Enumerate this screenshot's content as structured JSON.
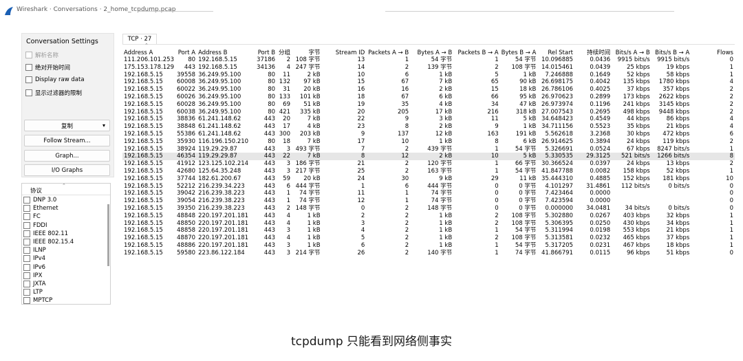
{
  "window": {
    "title": "Wireshark · Conversations · 2_home_tcpdump.pcap"
  },
  "settings": {
    "title": "Conversation Settings",
    "checkboxes": [
      {
        "label": "解析名称",
        "checked": false,
        "disabled": true
      },
      {
        "label": "绝对开始时间",
        "checked": false,
        "disabled": false
      },
      {
        "label": "Display raw data",
        "checked": false,
        "disabled": false
      },
      {
        "label": "显示过滤器的限制",
        "checked": false,
        "disabled": false
      }
    ],
    "buttons": {
      "copy": "复制",
      "follow": "Follow Stream...",
      "graph": "Graph...",
      "io": "I/O Graphs"
    }
  },
  "protocols": {
    "header": "协议",
    "items": [
      "DNP 3.0",
      "Ethernet",
      "FC",
      "FDDI",
      "IEEE 802.11",
      "IEEE 802.15.4",
      "ILNP",
      "IPv4",
      "IPv6",
      "IPX",
      "JXTA",
      "LTP",
      "MPTCP"
    ]
  },
  "tab": {
    "label": "TCP · 27"
  },
  "table": {
    "columns": [
      "Address A",
      "Port A",
      "Address B",
      "Port B",
      "分组",
      "字节",
      "Stream ID",
      "Packets A → B",
      "Bytes A → B",
      "Packets B → A",
      "Bytes B → A",
      "Rel Start",
      "持续时间",
      "Bits/s A → B",
      "Bits/s B → A",
      "Flows"
    ],
    "rows": [
      [
        "111.206.101.253",
        "80",
        "192.168.5.15",
        "37186",
        "2",
        "108 字节",
        "13",
        "1",
        "54 字节",
        "1",
        "54 字节",
        "10.096885",
        "0.0436",
        "9915 bits/s",
        "9915 bits/s",
        "0"
      ],
      [
        "175.153.178.129",
        "443",
        "192.168.5.15",
        "34136",
        "4",
        "247 字节",
        "14",
        "2",
        "139 字节",
        "2",
        "108 字节",
        "14.015461",
        "0.0439",
        "25 kbps",
        "19 kbps",
        "1"
      ],
      [
        "192.168.5.15",
        "39558",
        "36.249.95.100",
        "80",
        "11",
        "2 kB",
        "10",
        "6",
        "1 kB",
        "5",
        "1 kB",
        "7.246888",
        "0.1649",
        "52 kbps",
        "58 kbps",
        "1"
      ],
      [
        "192.168.5.15",
        "60008",
        "36.249.95.100",
        "80",
        "132",
        "97 kB",
        "15",
        "67",
        "7 kB",
        "65",
        "90 kB",
        "26.698175",
        "0.4042",
        "135 kbps",
        "1780 kbps",
        "4"
      ],
      [
        "192.168.5.15",
        "60022",
        "36.249.95.100",
        "80",
        "31",
        "20 kB",
        "16",
        "16",
        "2 kB",
        "15",
        "18 kB",
        "26.786106",
        "0.4025",
        "37 kbps",
        "357 kbps",
        "2"
      ],
      [
        "192.168.5.15",
        "60026",
        "36.249.95.100",
        "80",
        "133",
        "101 kB",
        "18",
        "67",
        "6 kB",
        "66",
        "95 kB",
        "26.970623",
        "0.2899",
        "173 kbps",
        "2622 kbps",
        "2"
      ],
      [
        "192.168.5.15",
        "60028",
        "36.249.95.100",
        "80",
        "69",
        "51 kB",
        "19",
        "35",
        "4 kB",
        "34",
        "47 kB",
        "26.973974",
        "0.1196",
        "241 kbps",
        "3145 kbps",
        "2"
      ],
      [
        "192.168.5.15",
        "60038",
        "36.249.95.100",
        "80",
        "421",
        "335 kB",
        "20",
        "205",
        "17 kB",
        "216",
        "318 kB",
        "27.007543",
        "0.2695",
        "498 kbps",
        "9448 kbps",
        "2"
      ],
      [
        "192.168.5.15",
        "38836",
        "61.241.148.62",
        "443",
        "20",
        "7 kB",
        "22",
        "9",
        "3 kB",
        "11",
        "5 kB",
        "34.648423",
        "0.4549",
        "44 kbps",
        "86 kbps",
        "4"
      ],
      [
        "192.168.5.15",
        "38848",
        "61.241.148.62",
        "443",
        "17",
        "4 kB",
        "23",
        "8",
        "2 kB",
        "9",
        "1 kB",
        "34.711156",
        "0.5523",
        "35 kbps",
        "21 kbps",
        "4"
      ],
      [
        "192.168.5.15",
        "55386",
        "61.241.148.62",
        "443",
        "300",
        "203 kB",
        "9",
        "137",
        "12 kB",
        "163",
        "191 kB",
        "5.562618",
        "3.2368",
        "30 kbps",
        "472 kbps",
        "6"
      ],
      [
        "192.168.5.15",
        "35930",
        "116.196.150.210",
        "80",
        "18",
        "7 kB",
        "17",
        "10",
        "1 kB",
        "8",
        "6 kB",
        "26.914625",
        "0.3894",
        "24 kbps",
        "119 kbps",
        "2"
      ],
      [
        "192.168.5.15",
        "38924",
        "119.29.29.87",
        "443",
        "3",
        "493 字节",
        "7",
        "2",
        "439 字节",
        "1",
        "54 字节",
        "5.326691",
        "0.0524",
        "67 kbps",
        "8247 bits/s",
        "1"
      ],
      [
        "192.168.5.15",
        "46354",
        "119.29.29.87",
        "443",
        "22",
        "7 kB",
        "8",
        "12",
        "2 kB",
        "10",
        "5 kB",
        "5.330535",
        "29.3125",
        "521 bits/s",
        "1266 bits/s",
        "8"
      ],
      [
        "192.168.5.15",
        "41912",
        "123.125.102.214",
        "443",
        "3",
        "186 字节",
        "21",
        "2",
        "120 字节",
        "1",
        "66 字节",
        "30.366524",
        "0.0397",
        "24 kbps",
        "13 kbps",
        "2"
      ],
      [
        "192.168.5.15",
        "42680",
        "125.64.35.248",
        "443",
        "3",
        "217 字节",
        "25",
        "2",
        "163 字节",
        "1",
        "54 字节",
        "41.847788",
        "0.0082",
        "158 kbps",
        "52 kbps",
        "1"
      ],
      [
        "192.168.5.15",
        "37744",
        "182.61.200.67",
        "443",
        "59",
        "20 kB",
        "24",
        "30",
        "9 kB",
        "29",
        "11 kB",
        "35.444310",
        "0.4885",
        "152 kbps",
        "181 kbps",
        "10"
      ],
      [
        "192.168.5.15",
        "52212",
        "216.239.34.223",
        "443",
        "6",
        "444 字节",
        "1",
        "6",
        "444 字节",
        "0",
        "0 字节",
        "4.101297",
        "31.4861",
        "112 bits/s",
        "0 bits/s",
        "0"
      ],
      [
        "192.168.5.15",
        "39042",
        "216.239.38.223",
        "443",
        "1",
        "74 字节",
        "11",
        "1",
        "74 字节",
        "0",
        "0 字节",
        "7.423464",
        "0.0000",
        "",
        "",
        "0"
      ],
      [
        "192.168.5.15",
        "39054",
        "216.239.38.223",
        "443",
        "1",
        "74 字节",
        "12",
        "1",
        "74 字节",
        "0",
        "0 字节",
        "7.423594",
        "0.0000",
        "",
        "",
        "0"
      ],
      [
        "192.168.5.15",
        "39350",
        "216.239.38.223",
        "443",
        "2",
        "148 字节",
        "0",
        "2",
        "148 字节",
        "0",
        "0 字节",
        "0.000000",
        "34.0481",
        "34 bits/s",
        "0 bits/s",
        "0"
      ],
      [
        "192.168.5.15",
        "48848",
        "220.197.201.181",
        "443",
        "4",
        "1 kB",
        "2",
        "2",
        "1 kB",
        "2",
        "108 字节",
        "5.302880",
        "0.0267",
        "403 kbps",
        "32 kbps",
        "1"
      ],
      [
        "192.168.5.15",
        "48850",
        "220.197.201.181",
        "443",
        "4",
        "1 kB",
        "3",
        "2",
        "1 kB",
        "2",
        "108 字节",
        "5.306395",
        "0.0250",
        "430 kbps",
        "34 kbps",
        "1"
      ],
      [
        "192.168.5.15",
        "48858",
        "220.197.201.181",
        "443",
        "3",
        "1 kB",
        "4",
        "2",
        "1 kB",
        "1",
        "54 字节",
        "5.311994",
        "0.0198",
        "553 kbps",
        "21 kbps",
        "1"
      ],
      [
        "192.168.5.15",
        "48870",
        "220.197.201.181",
        "443",
        "4",
        "1 kB",
        "5",
        "2",
        "1 kB",
        "2",
        "108 字节",
        "5.313581",
        "0.0232",
        "465 kbps",
        "37 kbps",
        "1"
      ],
      [
        "192.168.5.15",
        "48886",
        "220.197.201.181",
        "443",
        "3",
        "1 kB",
        "6",
        "2",
        "1 kB",
        "1",
        "54 字节",
        "5.317205",
        "0.0231",
        "467 kbps",
        "18 kbps",
        "1"
      ],
      [
        "192.168.5.15",
        "59580",
        "223.86.122.184",
        "443",
        "3",
        "214 字节",
        "26",
        "2",
        "140 字节",
        "1",
        "74 字节",
        "41.866791",
        "0.0115",
        "96 kbps",
        "51 kbps",
        "0"
      ]
    ],
    "selected_row": 13
  },
  "caption": "tcpdump 只能看到网络侧事实"
}
